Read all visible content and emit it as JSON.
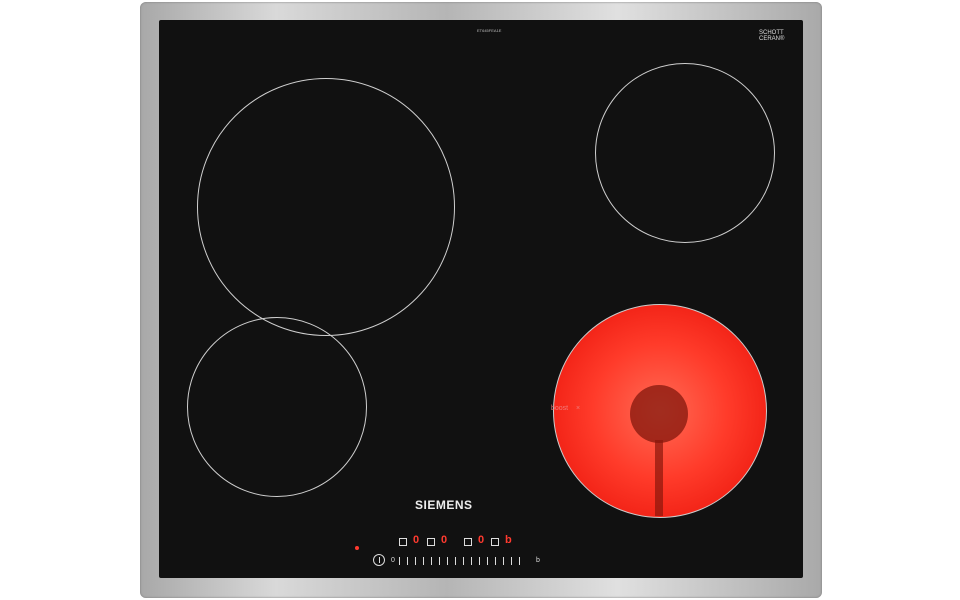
{
  "labels": {
    "model": "ET645FEA1E",
    "schott": "SCHOTT",
    "cerane": "CERAN®",
    "brand": "SIEMENS",
    "boost": "boost",
    "boost_symbol": "×",
    "zero": "0",
    "boost_label": "b",
    "digit_1": "0",
    "digit_2": "0",
    "digit_3": "0",
    "digit_4": "b"
  },
  "colors": {
    "glass": "#111111",
    "red_zone": "#ff3b2a",
    "indicator": "#ff3a2f"
  }
}
